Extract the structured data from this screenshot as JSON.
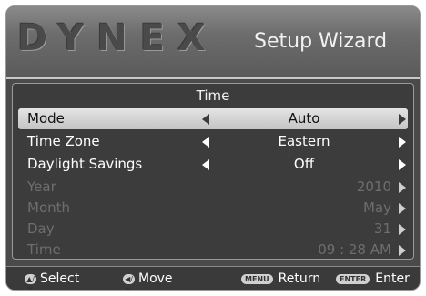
{
  "header": {
    "logo": "DYNEX",
    "title": "Setup Wizard"
  },
  "panel": {
    "title": "Time",
    "rows": [
      {
        "label": "Mode",
        "value": "Auto",
        "state": "selected"
      },
      {
        "label": "Time Zone",
        "value": "Eastern",
        "state": "enabled"
      },
      {
        "label": "Daylight Savings",
        "value": "Off",
        "state": "enabled"
      },
      {
        "label": "Year",
        "value": "2010",
        "state": "disabled"
      },
      {
        "label": "Month",
        "value": "May",
        "state": "disabled"
      },
      {
        "label": "Day",
        "value": "31",
        "state": "disabled"
      },
      {
        "label": "Time",
        "value": "09 : 28 AM",
        "state": "disabled"
      }
    ]
  },
  "footer": {
    "select": {
      "key": "▲/▼",
      "label": "Select"
    },
    "move": {
      "key": "◀/▶",
      "label": "Move"
    },
    "return": {
      "key": "MENU",
      "label": "Return"
    },
    "enter": {
      "key": "ENTER",
      "label": "Enter"
    }
  },
  "colors": {
    "background": "#4a4a4a",
    "panel": "#3c3c3c",
    "selected_row": "#d4d4d4",
    "disabled_text": "#6e6e6e"
  }
}
